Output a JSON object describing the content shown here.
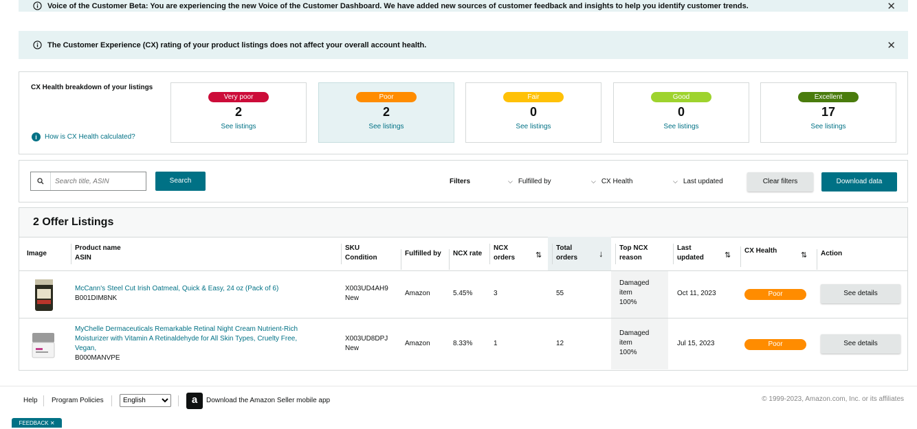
{
  "banners": {
    "beta": "Voice of the Customer Beta: You are experiencing the new Voice of the Customer Dashboard. We have added new sources of customer feedback and insights to help you identify customer trends.",
    "cx_note": "The Customer Experience (CX) rating of your product listings does not affect your overall account health.",
    "close_glyph": "✕"
  },
  "breakdown": {
    "title": "CX Health breakdown of your listings",
    "help_link": "How is CX Health calculated?",
    "help_glyph": "i",
    "cards": [
      {
        "label": "Very poor",
        "count": "2",
        "link": "See listings",
        "color": "#cc0c39"
      },
      {
        "label": "Poor",
        "count": "2",
        "link": "See listings",
        "color": "#ff8c00"
      },
      {
        "label": "Fair",
        "count": "0",
        "link": "See listings",
        "color": "#ffc107"
      },
      {
        "label": "Good",
        "count": "0",
        "link": "See listings",
        "color": "#9ed32e"
      },
      {
        "label": "Excellent",
        "count": "17",
        "link": "See listings",
        "color": "#4a7c0d"
      }
    ]
  },
  "filters": {
    "search_placeholder": "Search title, ASIN",
    "search_button": "Search",
    "filters_label": "Filters",
    "fulfilled_by": "Fulfilled by",
    "cx_health": "CX Health",
    "last_updated": "Last updated",
    "clear_filters": "Clear filters",
    "download_data": "Download data"
  },
  "listings": {
    "title": "2 Offer Listings",
    "headers": {
      "image": "Image",
      "product_name": "Product name",
      "asin": "ASIN",
      "sku": "SKU",
      "condition": "Condition",
      "fulfilled_by": "Fulfilled by",
      "ncx_rate": "NCX rate",
      "ncx_orders_1": "NCX",
      "ncx_orders_2": "orders",
      "total_orders_1": "Total",
      "total_orders_2": "orders",
      "top_ncx_1": "Top NCX",
      "top_ncx_2": "reason",
      "last_updated_1": "Last",
      "last_updated_2": "updated",
      "cx_health": "CX Health",
      "action": "Action"
    },
    "rows": [
      {
        "product_name": "McCann's Steel Cut Irish Oatmeal, Quick & Easy, 24 oz (Pack of 6)",
        "asin": "B001DIM8NK",
        "sku": "X003UD4AH9",
        "condition": "New",
        "fulfilled_by": "Amazon",
        "ncx_rate": "5.45%",
        "ncx_orders": "3",
        "total_orders": "55",
        "reason_1": "Damaged",
        "reason_2": "item",
        "reason_3": "100%",
        "last_updated": "Oct 11, 2023",
        "cx_health": "Poor",
        "action": "See details"
      },
      {
        "product_name_1": "MyChelle Dermaceuticals Remarkable Retinal Night Cream Nutrient-Rich",
        "product_name_2": "Moisturizer with Vitamin A Retinaldehyde for All Skin Types, Cruelty Free,",
        "product_name_3": "Vegan,",
        "asin": "B000MANVPE",
        "sku": "X003UD8DPJ",
        "condition": "New",
        "fulfilled_by": "Amazon",
        "ncx_rate": "8.33%",
        "ncx_orders": "1",
        "total_orders": "12",
        "reason_1": "Damaged",
        "reason_2": "item",
        "reason_3": "100%",
        "last_updated": "Jul 15, 2023",
        "cx_health": "Poor",
        "action": "See details"
      }
    ]
  },
  "footer": {
    "help": "Help",
    "program_policies": "Program Policies",
    "language": "English",
    "app_logo": "a",
    "app_link": "Download the Amazon Seller mobile app",
    "copyright": "© 1999-2023, Amazon.com, Inc. or its affiliates",
    "feedback": "FEEDBACK ✕"
  }
}
